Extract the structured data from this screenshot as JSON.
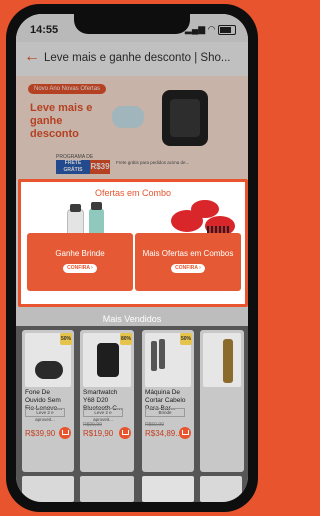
{
  "status": {
    "time": "14:55"
  },
  "nav": {
    "back_icon": "back-arrow-icon",
    "title": "Leve mais e ganhe desconto | Sho..."
  },
  "banner": {
    "pill": "Novo Ano Novas Ofertas",
    "headline": "Leve mais e ganhe desconto",
    "program": "PROGRAMA DE",
    "frete": "FRETE GRÁTIS",
    "frete_value": "R$39",
    "fine_print": "Frete grátis para pedidos acima de..."
  },
  "combo": {
    "title": "Ofertas em Combo",
    "cards": [
      {
        "label": "Ganhe Brinde",
        "button": "CONFIRA ›"
      },
      {
        "label": "Mais Ofertas em Combos",
        "button": "CONFIRA ›"
      }
    ]
  },
  "mais_vendidos": {
    "title": "Mais Vendidos"
  },
  "products": [
    {
      "name": "Fone De Ouvido Sem Fio Lenovo...",
      "tag": "Leve 2 e aproveit...",
      "old_price": "",
      "price": "R$39,90",
      "discount": "50%"
    },
    {
      "name": "Smartwatch Y68 D20 Bluetooth C...",
      "tag": "Leve 2 e aproveit...",
      "old_price": "R$99,90",
      "price": "R$19,90",
      "discount": "80%"
    },
    {
      "name": "Máquina De Cortar Cabelo Para Bar...",
      "tag": "Brinde",
      "old_price": "R$69,90",
      "price": "R$34,89...",
      "discount": "50%"
    }
  ],
  "colors": {
    "brand": "#e8542d"
  }
}
